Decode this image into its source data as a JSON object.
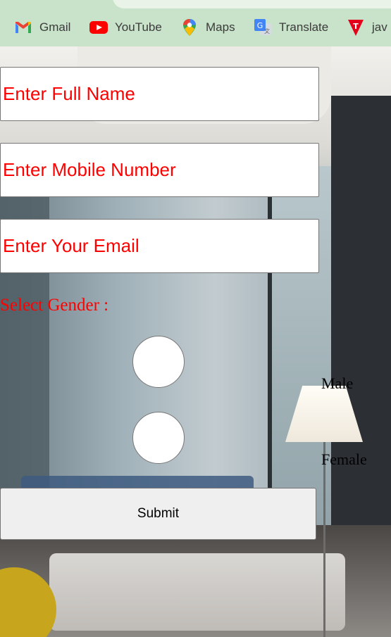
{
  "bookmarks": [
    {
      "label": "Gmail",
      "icon": "gmail-icon"
    },
    {
      "label": "YouTube",
      "icon": "youtube-icon"
    },
    {
      "label": "Maps",
      "icon": "maps-icon"
    },
    {
      "label": "Translate",
      "icon": "translate-icon"
    },
    {
      "label": "jav",
      "icon": "t-logo-icon"
    }
  ],
  "form": {
    "full_name_placeholder": "Enter Full Name",
    "mobile_placeholder": "Enter Mobile Number",
    "email_placeholder": "Enter Your Email",
    "gender_label": "Select Gender :",
    "male_label": "Male",
    "female_label": "Female",
    "submit_label": "Submit"
  },
  "colors": {
    "placeholder": "#ff0000",
    "bookmarks_bar": "#c8e3c9"
  }
}
